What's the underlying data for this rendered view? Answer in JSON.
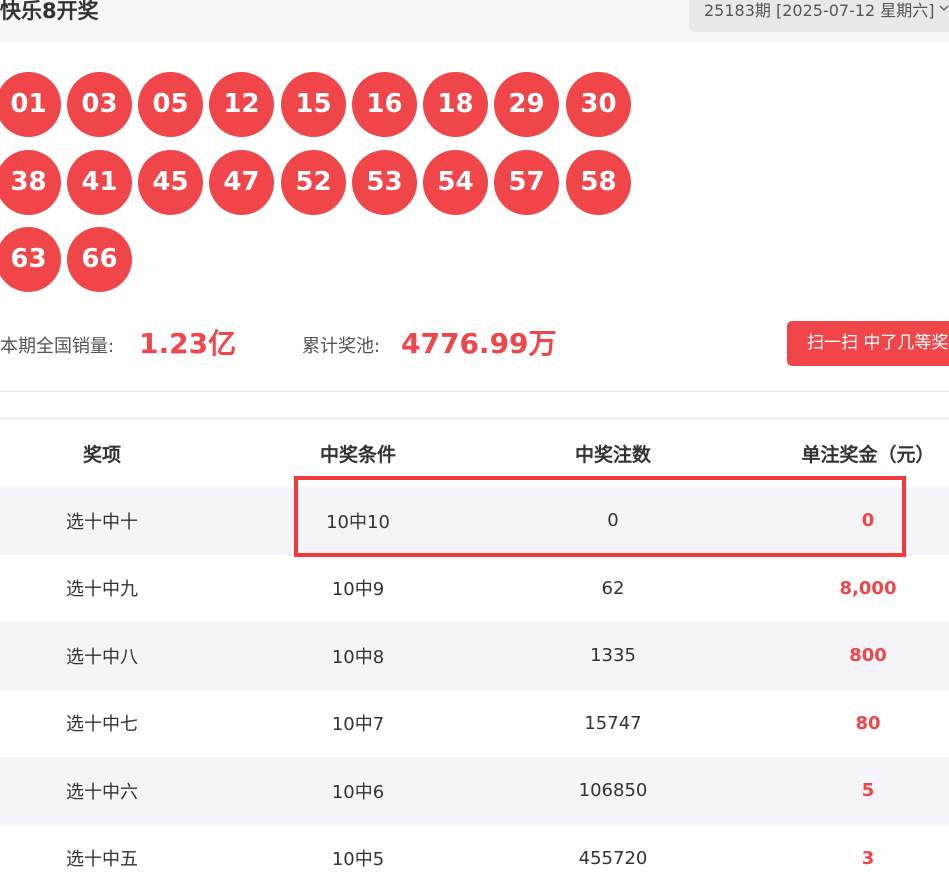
{
  "header": {
    "title": "快乐8开奖",
    "period_select": "25183期 [2025-07-12 星期六]"
  },
  "balls": [
    "01",
    "03",
    "05",
    "12",
    "15",
    "16",
    "18",
    "29",
    "30",
    "38",
    "41",
    "45",
    "47",
    "52",
    "53",
    "54",
    "57",
    "58",
    "63",
    "66"
  ],
  "stats": {
    "sales_label": "本期全国销量:",
    "sales_value": "1.23亿",
    "pool_label": "累计奖池:",
    "pool_value": "4776.99万",
    "scan_button": "扫一扫 中了几等奖"
  },
  "table": {
    "headers": [
      "奖项",
      "中奖条件",
      "中奖注数",
      "单注奖金（元）"
    ],
    "rows": [
      {
        "item": "选十中十",
        "condition": "10中10",
        "count": "0",
        "prize": "0"
      },
      {
        "item": "选十中九",
        "condition": "10中9",
        "count": "62",
        "prize": "8,000"
      },
      {
        "item": "选十中八",
        "condition": "10中8",
        "count": "1335",
        "prize": "800"
      },
      {
        "item": "选十中七",
        "condition": "10中7",
        "count": "15747",
        "prize": "80"
      },
      {
        "item": "选十中六",
        "condition": "10中6",
        "count": "106850",
        "prize": "5"
      },
      {
        "item": "选十中五",
        "condition": "10中5",
        "count": "455720",
        "prize": "3"
      }
    ]
  },
  "colors": {
    "ball": "#f0464a",
    "accent": "#f0464a",
    "highlight_box": "#ef3b3b"
  },
  "icons": {
    "dropdown": "chevron-down-icon"
  }
}
